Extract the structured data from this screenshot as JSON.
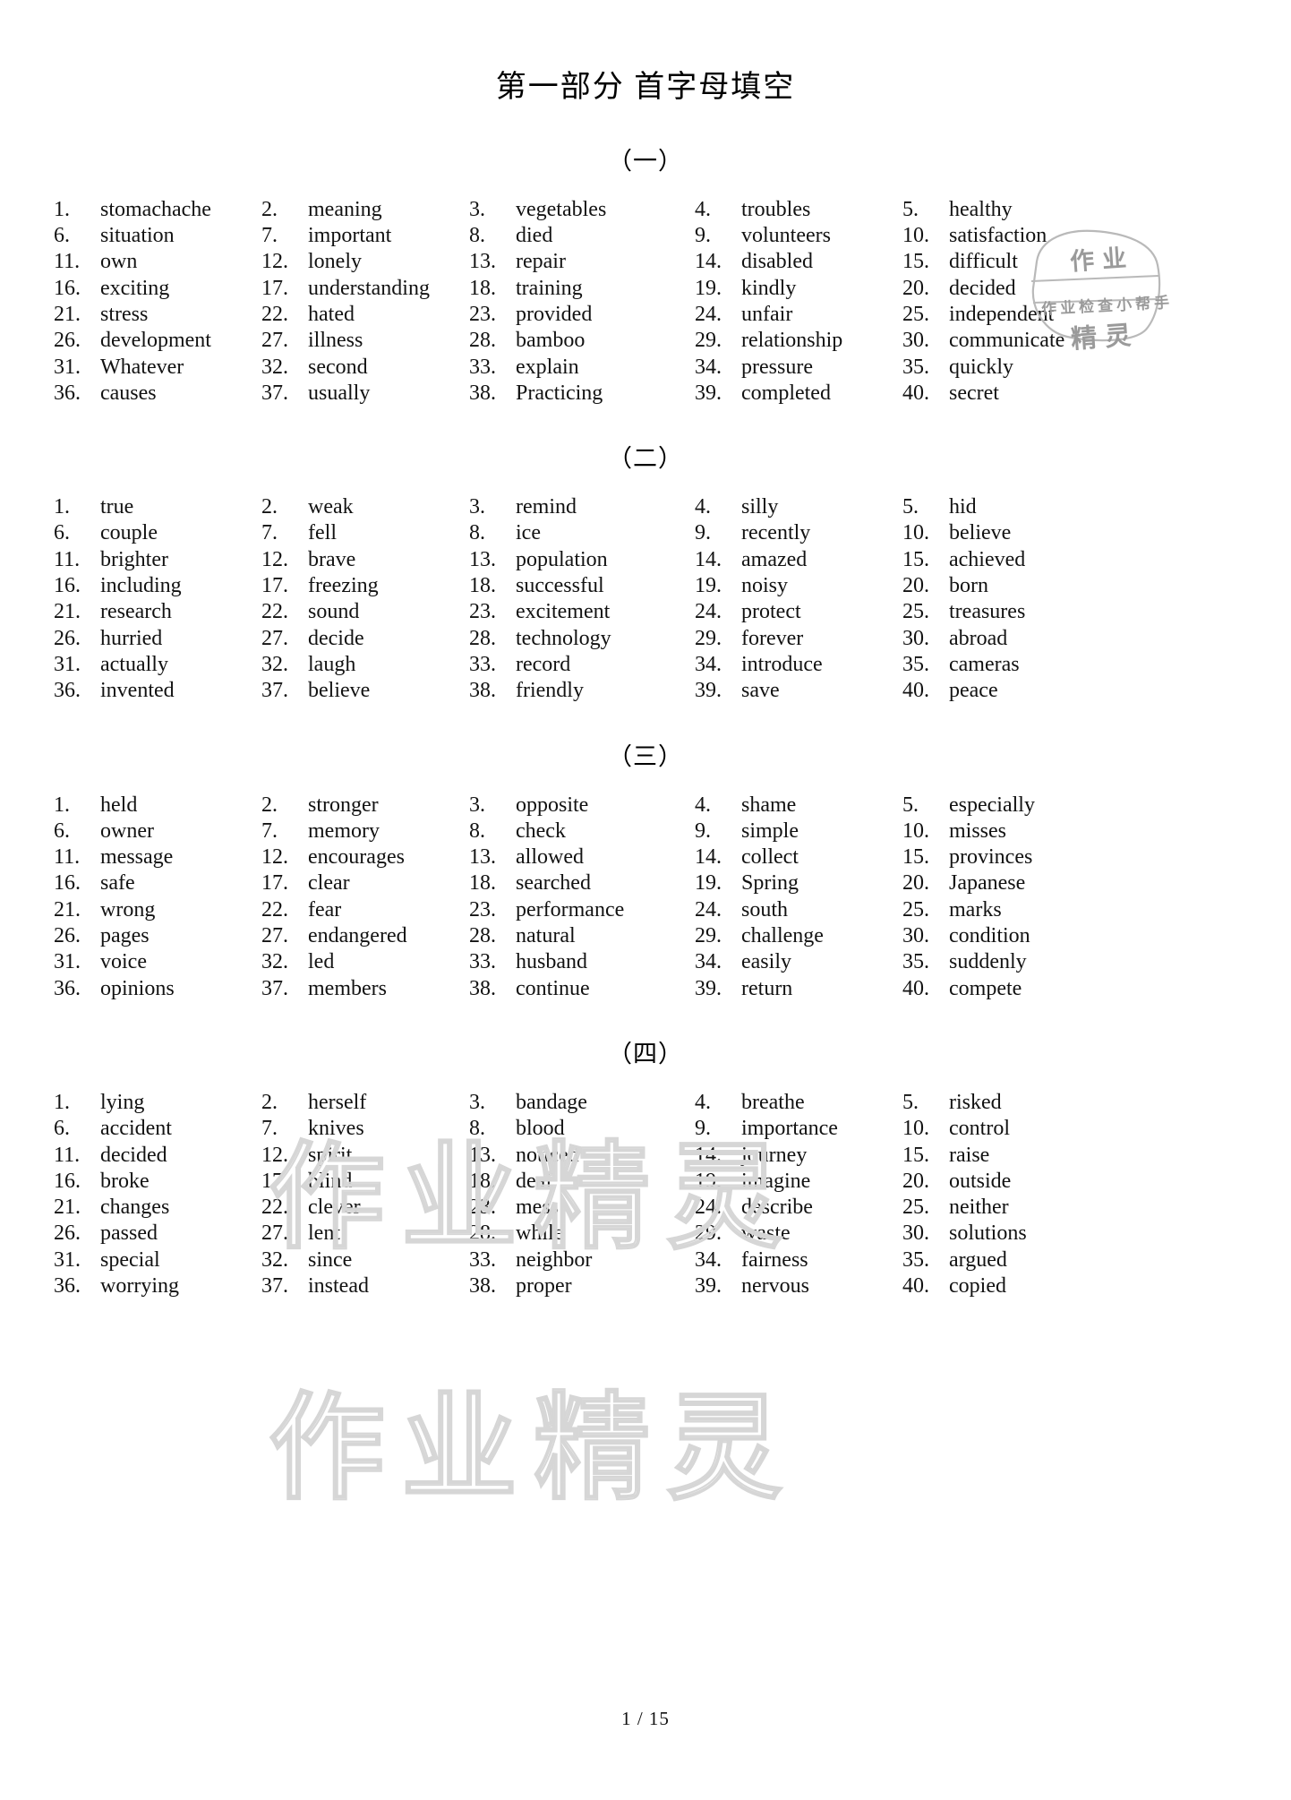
{
  "document": {
    "title": "第一部分  首字母填空",
    "footer": "1 / 15"
  },
  "watermarks": {
    "stamp": {
      "top_text": "作业",
      "middle_text": "作业检查小帮手",
      "bottom_text": "精灵"
    },
    "background_text": "作业精灵"
  },
  "sections": [
    {
      "label": "（一）",
      "items": [
        {
          "n": "1.",
          "w": "stomachache"
        },
        {
          "n": "2.",
          "w": "meaning"
        },
        {
          "n": "3.",
          "w": "vegetables"
        },
        {
          "n": "4.",
          "w": "troubles"
        },
        {
          "n": "5.",
          "w": "healthy"
        },
        {
          "n": "6.",
          "w": "situation"
        },
        {
          "n": "7.",
          "w": "important"
        },
        {
          "n": "8.",
          "w": "died"
        },
        {
          "n": "9.",
          "w": "volunteers"
        },
        {
          "n": "10.",
          "w": "satisfaction"
        },
        {
          "n": "11.",
          "w": "own"
        },
        {
          "n": "12.",
          "w": "lonely"
        },
        {
          "n": "13.",
          "w": "repair"
        },
        {
          "n": "14.",
          "w": "disabled"
        },
        {
          "n": "15.",
          "w": "difficult"
        },
        {
          "n": "16.",
          "w": "exciting"
        },
        {
          "n": "17.",
          "w": "understanding"
        },
        {
          "n": "18.",
          "w": "training"
        },
        {
          "n": "19.",
          "w": "kindly"
        },
        {
          "n": "20.",
          "w": "decided"
        },
        {
          "n": "21.",
          "w": "stress"
        },
        {
          "n": "22.",
          "w": "hated"
        },
        {
          "n": "23.",
          "w": "provided"
        },
        {
          "n": "24.",
          "w": "unfair"
        },
        {
          "n": "25.",
          "w": "independent"
        },
        {
          "n": "26.",
          "w": "development"
        },
        {
          "n": "27.",
          "w": "illness"
        },
        {
          "n": "28.",
          "w": "bamboo"
        },
        {
          "n": "29.",
          "w": "relationship"
        },
        {
          "n": "30.",
          "w": "communicate"
        },
        {
          "n": "31.",
          "w": "Whatever"
        },
        {
          "n": "32.",
          "w": "second"
        },
        {
          "n": "33.",
          "w": "explain"
        },
        {
          "n": "34.",
          "w": "pressure"
        },
        {
          "n": "35.",
          "w": "quickly"
        },
        {
          "n": "36.",
          "w": "causes"
        },
        {
          "n": "37.",
          "w": "usually"
        },
        {
          "n": "38.",
          "w": "Practicing"
        },
        {
          "n": "39.",
          "w": "completed"
        },
        {
          "n": "40.",
          "w": "secret"
        }
      ]
    },
    {
      "label": "（二）",
      "items": [
        {
          "n": "1.",
          "w": "true"
        },
        {
          "n": "2.",
          "w": "weak"
        },
        {
          "n": "3.",
          "w": "remind"
        },
        {
          "n": "4.",
          "w": "silly"
        },
        {
          "n": "5.",
          "w": "hid"
        },
        {
          "n": "6.",
          "w": "couple"
        },
        {
          "n": "7.",
          "w": "fell"
        },
        {
          "n": "8.",
          "w": "ice"
        },
        {
          "n": "9.",
          "w": "recently"
        },
        {
          "n": "10.",
          "w": "believe"
        },
        {
          "n": "11.",
          "w": "brighter"
        },
        {
          "n": "12.",
          "w": "brave"
        },
        {
          "n": "13.",
          "w": "population"
        },
        {
          "n": "14.",
          "w": "amazed"
        },
        {
          "n": "15.",
          "w": "achieved"
        },
        {
          "n": "16.",
          "w": "including"
        },
        {
          "n": "17.",
          "w": "freezing"
        },
        {
          "n": "18.",
          "w": "successful"
        },
        {
          "n": "19.",
          "w": "noisy"
        },
        {
          "n": "20.",
          "w": "born"
        },
        {
          "n": "21.",
          "w": "research"
        },
        {
          "n": "22.",
          "w": "sound"
        },
        {
          "n": "23.",
          "w": "excitement"
        },
        {
          "n": "24.",
          "w": "protect"
        },
        {
          "n": "25.",
          "w": "treasures"
        },
        {
          "n": "26.",
          "w": "hurried"
        },
        {
          "n": "27.",
          "w": "decide"
        },
        {
          "n": "28.",
          "w": "technology"
        },
        {
          "n": "29.",
          "w": "forever"
        },
        {
          "n": "30.",
          "w": "abroad"
        },
        {
          "n": "31.",
          "w": "actually"
        },
        {
          "n": "32.",
          "w": "laugh"
        },
        {
          "n": "33.",
          "w": "record"
        },
        {
          "n": "34.",
          "w": "introduce"
        },
        {
          "n": "35.",
          "w": "cameras"
        },
        {
          "n": "36.",
          "w": "invented"
        },
        {
          "n": "37.",
          "w": "believe"
        },
        {
          "n": "38.",
          "w": "friendly"
        },
        {
          "n": "39.",
          "w": "save"
        },
        {
          "n": "40.",
          "w": "peace"
        }
      ]
    },
    {
      "label": "（三）",
      "items": [
        {
          "n": "1.",
          "w": "held"
        },
        {
          "n": "2.",
          "w": "stronger"
        },
        {
          "n": "3.",
          "w": "opposite"
        },
        {
          "n": "4.",
          "w": "shame"
        },
        {
          "n": "5.",
          "w": "especially"
        },
        {
          "n": "6.",
          "w": "owner"
        },
        {
          "n": "7.",
          "w": "memory"
        },
        {
          "n": "8.",
          "w": "check"
        },
        {
          "n": "9.",
          "w": "simple"
        },
        {
          "n": "10.",
          "w": "misses"
        },
        {
          "n": "11.",
          "w": "message"
        },
        {
          "n": "12.",
          "w": "encourages"
        },
        {
          "n": "13.",
          "w": "allowed"
        },
        {
          "n": "14.",
          "w": "collect"
        },
        {
          "n": "15.",
          "w": "provinces"
        },
        {
          "n": "16.",
          "w": "safe"
        },
        {
          "n": "17.",
          "w": "clear"
        },
        {
          "n": "18.",
          "w": "searched"
        },
        {
          "n": "19.",
          "w": "Spring"
        },
        {
          "n": "20.",
          "w": "Japanese"
        },
        {
          "n": "21.",
          "w": "wrong"
        },
        {
          "n": "22.",
          "w": "fear"
        },
        {
          "n": "23.",
          "w": "performance"
        },
        {
          "n": "24.",
          "w": "south"
        },
        {
          "n": "25.",
          "w": "marks"
        },
        {
          "n": "26.",
          "w": "pages"
        },
        {
          "n": "27.",
          "w": "endangered"
        },
        {
          "n": "28.",
          "w": "natural"
        },
        {
          "n": "29.",
          "w": "challenge"
        },
        {
          "n": "30.",
          "w": "condition"
        },
        {
          "n": "31.",
          "w": "voice"
        },
        {
          "n": "32.",
          "w": "led"
        },
        {
          "n": "33.",
          "w": "husband"
        },
        {
          "n": "34.",
          "w": "easily"
        },
        {
          "n": "35.",
          "w": "suddenly"
        },
        {
          "n": "36.",
          "w": "opinions"
        },
        {
          "n": "37.",
          "w": "members"
        },
        {
          "n": "38.",
          "w": "continue"
        },
        {
          "n": "39.",
          "w": "return"
        },
        {
          "n": "40.",
          "w": "compete"
        }
      ]
    },
    {
      "label": "（四）",
      "items": [
        {
          "n": "1.",
          "w": "lying"
        },
        {
          "n": "2.",
          "w": "herself"
        },
        {
          "n": "3.",
          "w": "bandage"
        },
        {
          "n": "4.",
          "w": "breathe"
        },
        {
          "n": "5.",
          "w": "risked"
        },
        {
          "n": "6.",
          "w": "accident"
        },
        {
          "n": "7.",
          "w": "knives"
        },
        {
          "n": "8.",
          "w": "blood"
        },
        {
          "n": "9.",
          "w": "importance"
        },
        {
          "n": "10.",
          "w": "control"
        },
        {
          "n": "11.",
          "w": "decided"
        },
        {
          "n": "12.",
          "w": "spirit"
        },
        {
          "n": "13.",
          "w": "noticed"
        },
        {
          "n": "14.",
          "w": "journey"
        },
        {
          "n": "15.",
          "w": "raise"
        },
        {
          "n": "16.",
          "w": "broke"
        },
        {
          "n": "17.",
          "w": "blind"
        },
        {
          "n": "18.",
          "w": "deaf"
        },
        {
          "n": "19.",
          "w": "imagine"
        },
        {
          "n": "20.",
          "w": "outside"
        },
        {
          "n": "21.",
          "w": "changes"
        },
        {
          "n": "22.",
          "w": "clever"
        },
        {
          "n": "23.",
          "w": "mess"
        },
        {
          "n": "24.",
          "w": "describe"
        },
        {
          "n": "25.",
          "w": "neither"
        },
        {
          "n": "26.",
          "w": "passed"
        },
        {
          "n": "27.",
          "w": "lent"
        },
        {
          "n": "28.",
          "w": "while"
        },
        {
          "n": "29.",
          "w": "waste"
        },
        {
          "n": "30.",
          "w": "solutions"
        },
        {
          "n": "31.",
          "w": "special"
        },
        {
          "n": "32.",
          "w": "since"
        },
        {
          "n": "33.",
          "w": "neighbor"
        },
        {
          "n": "34.",
          "w": "fairness"
        },
        {
          "n": "35.",
          "w": "argued"
        },
        {
          "n": "36.",
          "w": "worrying"
        },
        {
          "n": "37.",
          "w": "instead"
        },
        {
          "n": "38.",
          "w": "proper"
        },
        {
          "n": "39.",
          "w": "nervous"
        },
        {
          "n": "40.",
          "w": "copied"
        }
      ]
    }
  ]
}
